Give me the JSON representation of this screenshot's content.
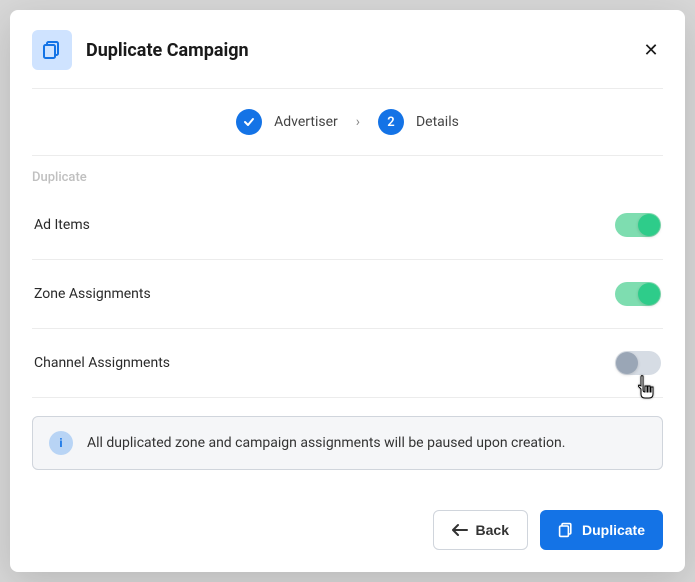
{
  "modal": {
    "title": "Duplicate Campaign",
    "close_symbol": "✕"
  },
  "stepper": {
    "step1": {
      "label": "Advertiser",
      "state": "done"
    },
    "step2": {
      "number": "2",
      "label": "Details",
      "state": "active"
    },
    "chevron": "›"
  },
  "section_label": "Duplicate",
  "options": {
    "ad_items": {
      "label": "Ad Items",
      "enabled": true
    },
    "zone": {
      "label": "Zone Assignments",
      "enabled": true
    },
    "channel": {
      "label": "Channel Assignments",
      "enabled": false
    }
  },
  "info": {
    "icon_letter": "i",
    "text": "All duplicated zone and campaign assignments will be paused upon creation."
  },
  "footer": {
    "back_label": "Back",
    "duplicate_label": "Duplicate"
  },
  "colors": {
    "primary": "#1473e6",
    "toggle_on": "#2ecc8a"
  }
}
